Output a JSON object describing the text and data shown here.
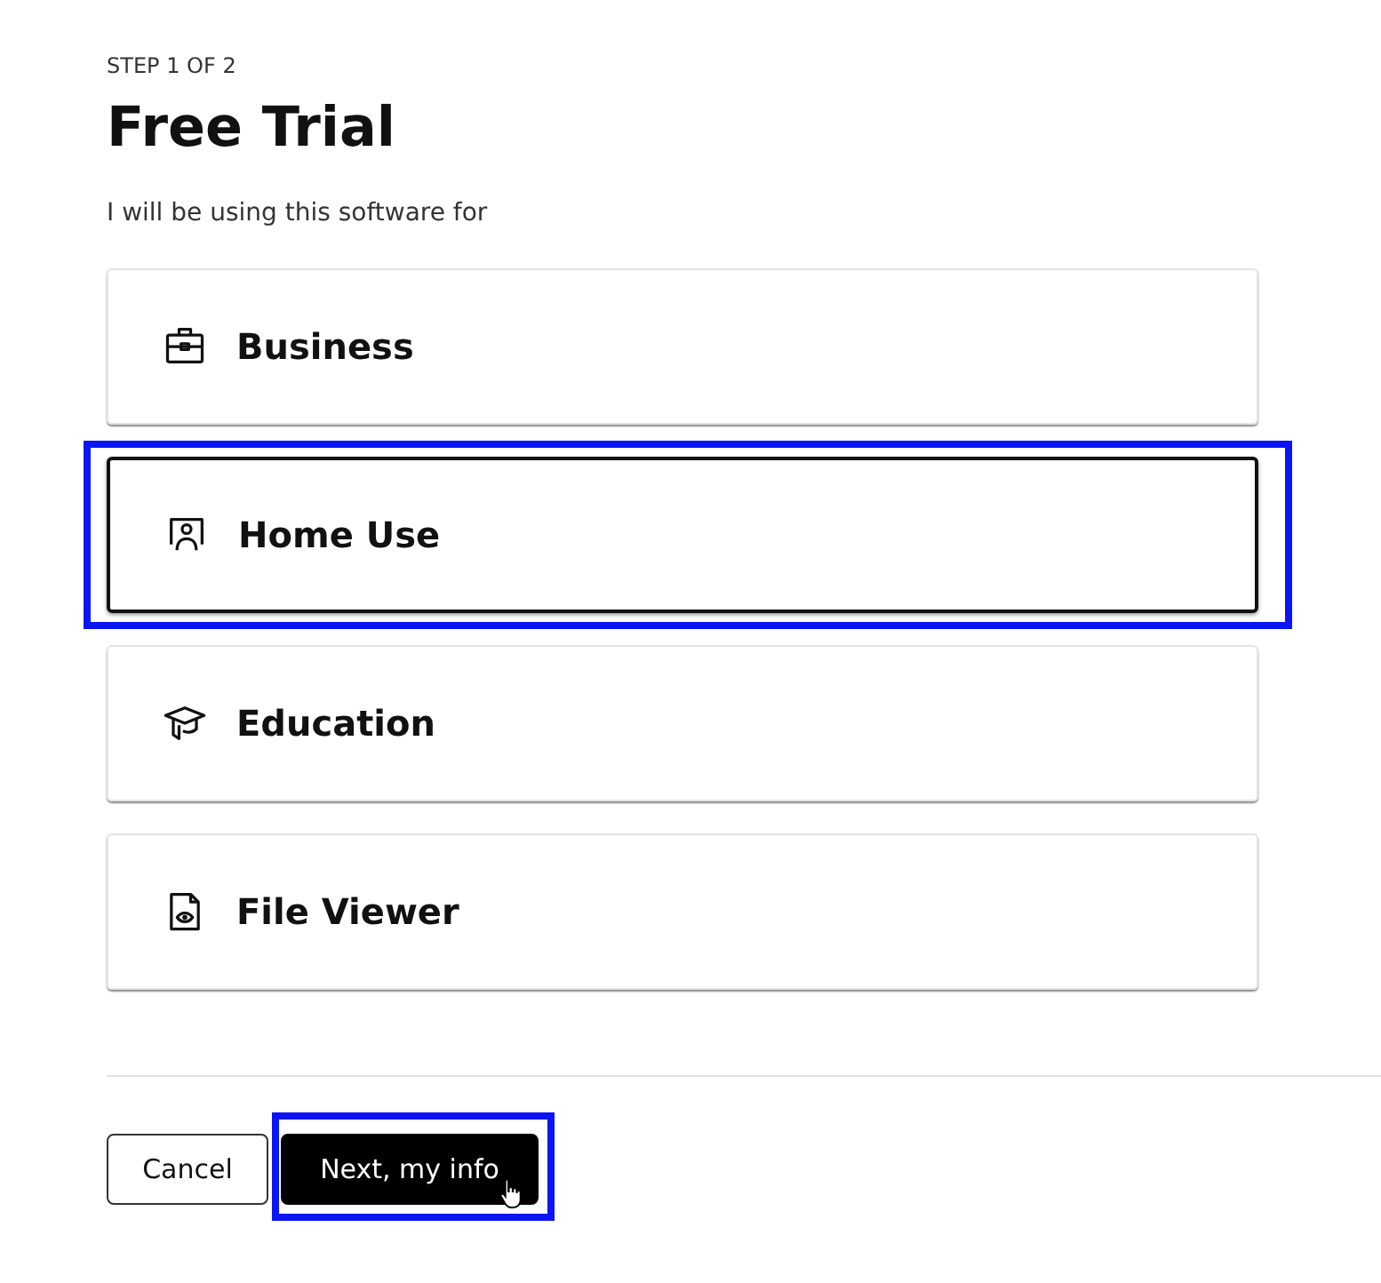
{
  "step": "STEP 1 OF 2",
  "title": "Free Trial",
  "prompt": "I will be using this software for",
  "options": [
    {
      "label": "Business",
      "kind": "briefcase",
      "selected": false,
      "highlighted": false
    },
    {
      "label": "Home Use",
      "kind": "presenter",
      "selected": true,
      "highlighted": true
    },
    {
      "label": "Education",
      "kind": "graduation",
      "selected": false,
      "highlighted": false
    },
    {
      "label": "File Viewer",
      "kind": "file-view",
      "selected": false,
      "highlighted": false
    }
  ],
  "buttons": [
    {
      "label": "Cancel",
      "kind": "secondary",
      "highlighted": false,
      "hovered": false
    },
    {
      "label": "Next, my info",
      "kind": "primary",
      "highlighted": true,
      "hovered": true
    }
  ]
}
